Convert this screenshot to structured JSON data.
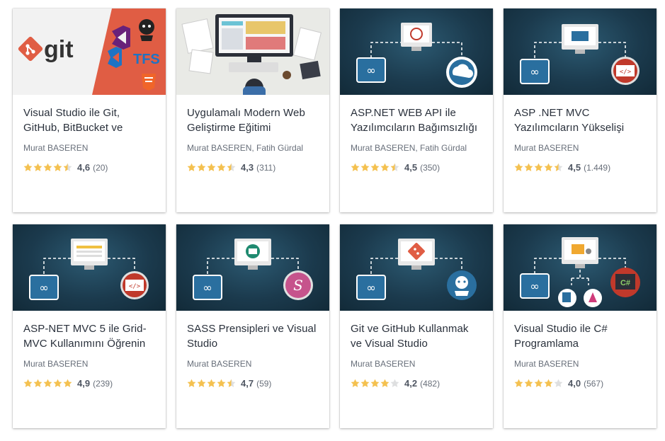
{
  "courses": [
    {
      "title": "Visual Studio ile Git, GitHub, BitBucket ve TFS…",
      "author": "Murat BASEREN",
      "rating": "4,6",
      "rating_value": 4.6,
      "reviews": "(20)",
      "thumbnail": "git-tfs-thumbnail",
      "thumb_text": {
        "git": "git",
        "tfs": "TFS"
      }
    },
    {
      "title": "Uygulamalı Modern Web Geliştirme Eğitimi",
      "author": "Murat BASEREN, Fatih Gürdal",
      "rating": "4,3",
      "rating_value": 4.3,
      "reviews": "(311)",
      "thumbnail": "web-desk-thumbnail"
    },
    {
      "title": "ASP.NET WEB API ile Yazılımcıların Bağımsızlığı",
      "author": "Murat BASEREN, Fatih Gürdal",
      "rating": "4,5",
      "rating_value": 4.5,
      "reviews": "(350)",
      "thumbnail": "web-api-thumbnail"
    },
    {
      "title": "ASP .NET MVC Yazılımcıların Yükselişi",
      "author": "Murat BASEREN",
      "rating": "4,5",
      "rating_value": 4.5,
      "reviews": "(1.449)",
      "thumbnail": "mvc-thumbnail"
    },
    {
      "title": "ASP-NET MVC 5 ile Grid-MVC Kullanımını Öğrenin",
      "author": "Murat BASEREN",
      "rating": "4,9",
      "rating_value": 4.9,
      "reviews": "(239)",
      "thumbnail": "grid-mvc-thumbnail"
    },
    {
      "title": "SASS Prensipleri ve Visual Studio",
      "author": "Murat BASEREN",
      "rating": "4,7",
      "rating_value": 4.7,
      "reviews": "(59)",
      "thumbnail": "sass-thumbnail"
    },
    {
      "title": "Git ve GitHub Kullanmak ve Visual Studio",
      "author": "Murat BASEREN",
      "rating": "4,2",
      "rating_value": 4.2,
      "reviews": "(482)",
      "thumbnail": "git-github-thumbnail"
    },
    {
      "title": "Visual Studio ile C# Programlama",
      "author": "Murat BASEREN",
      "rating": "4,0",
      "rating_value": 4.0,
      "reviews": "(567)",
      "thumbnail": "csharp-thumbnail",
      "thumb_text": {
        "cs": "C#"
      }
    }
  ],
  "colors": {
    "star_filled": "#f4c150",
    "star_empty": "#dedfe0",
    "title": "#29303b",
    "muted": "#686f7a",
    "thumb_bg": "#1b3a4d",
    "git_orange": "#e05d44",
    "accent_blue": "#2a6f9f"
  }
}
